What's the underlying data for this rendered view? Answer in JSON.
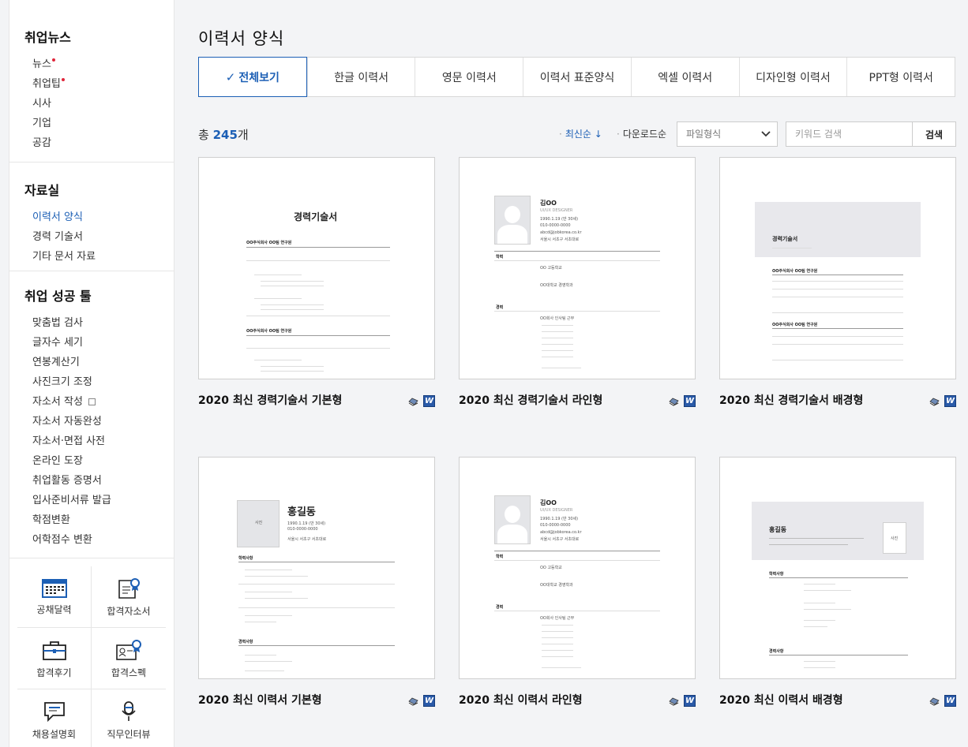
{
  "sidebar": {
    "news_title": "취업뉴스",
    "news_items": [
      "뉴스",
      "취업팁",
      "시사",
      "기업",
      "공감"
    ],
    "data_title": "자료실",
    "data_items": [
      "이력서 양식",
      "경력 기술서",
      "기타 문서 자료"
    ],
    "tools_title": "취업 성공 툴",
    "tools_items": [
      "맞춤법 검사",
      "글자수 세기",
      "연봉계산기",
      "사진크기 조정",
      "자소서 작성",
      "자소서 자동완성",
      "자소서·면접 사전",
      "온라인 도장",
      "취업활동 증명서",
      "입사준비서류 발급",
      "학점변환",
      "어학점수 변환"
    ],
    "grid": [
      "공채달력",
      "합격자소서",
      "합격후기",
      "합격스펙",
      "채용설명회",
      "직무인터뷰"
    ]
  },
  "page_title": "이력서 양식",
  "tabs": [
    "전체보기",
    "한글 이력서",
    "영문 이력서",
    "이력서 표준양식",
    "엑셀 이력서",
    "디자인형 이력서",
    "PPT형 이력서"
  ],
  "tab_check": "✓",
  "total": {
    "prefix": "총 ",
    "count": "245",
    "suffix": "개"
  },
  "sort": {
    "latest": "최신순 ↓",
    "downloads": "다운로드순"
  },
  "filter": {
    "selected": "파일형식"
  },
  "search": {
    "placeholder": "키워드 검색",
    "button": "검색"
  },
  "cards": [
    {
      "title": "2020 최신 경력기술서 기본형"
    },
    {
      "title": "2020 최신 경력기술서 라인형"
    },
    {
      "title": "2020 최신 경력기술서 배경형"
    },
    {
      "title": "2020 최신 이력서 기본형"
    },
    {
      "title": "2020 최신 이력서 라인형"
    },
    {
      "title": "2020 최신 이력서 배경형"
    }
  ],
  "file_icon_w": "W",
  "doc": {
    "career_title": "경력기술서",
    "company1": "OO주식회사 OO팀 연구원",
    "company2": "OO주식회사 OO팀 연구원",
    "name_kim": "김OO",
    "designer": "UI/UX DESIGNER",
    "birth": "1990.1.19 (만 30세)",
    "phone": "010-0000-0000",
    "email": "abcd@jobkorea.co.kr",
    "addr": "서울시 서초구 서초대로",
    "edu_label": "학력",
    "career_label": "경력",
    "edu1": "OO 고등학교",
    "edu2": "OO대학교 경영학과",
    "work1": "OO회사 인사팀 근무",
    "name_hong": "홍길동",
    "photo_label": "사진",
    "section_edu": "학력사항",
    "section_career": "경력사항"
  }
}
